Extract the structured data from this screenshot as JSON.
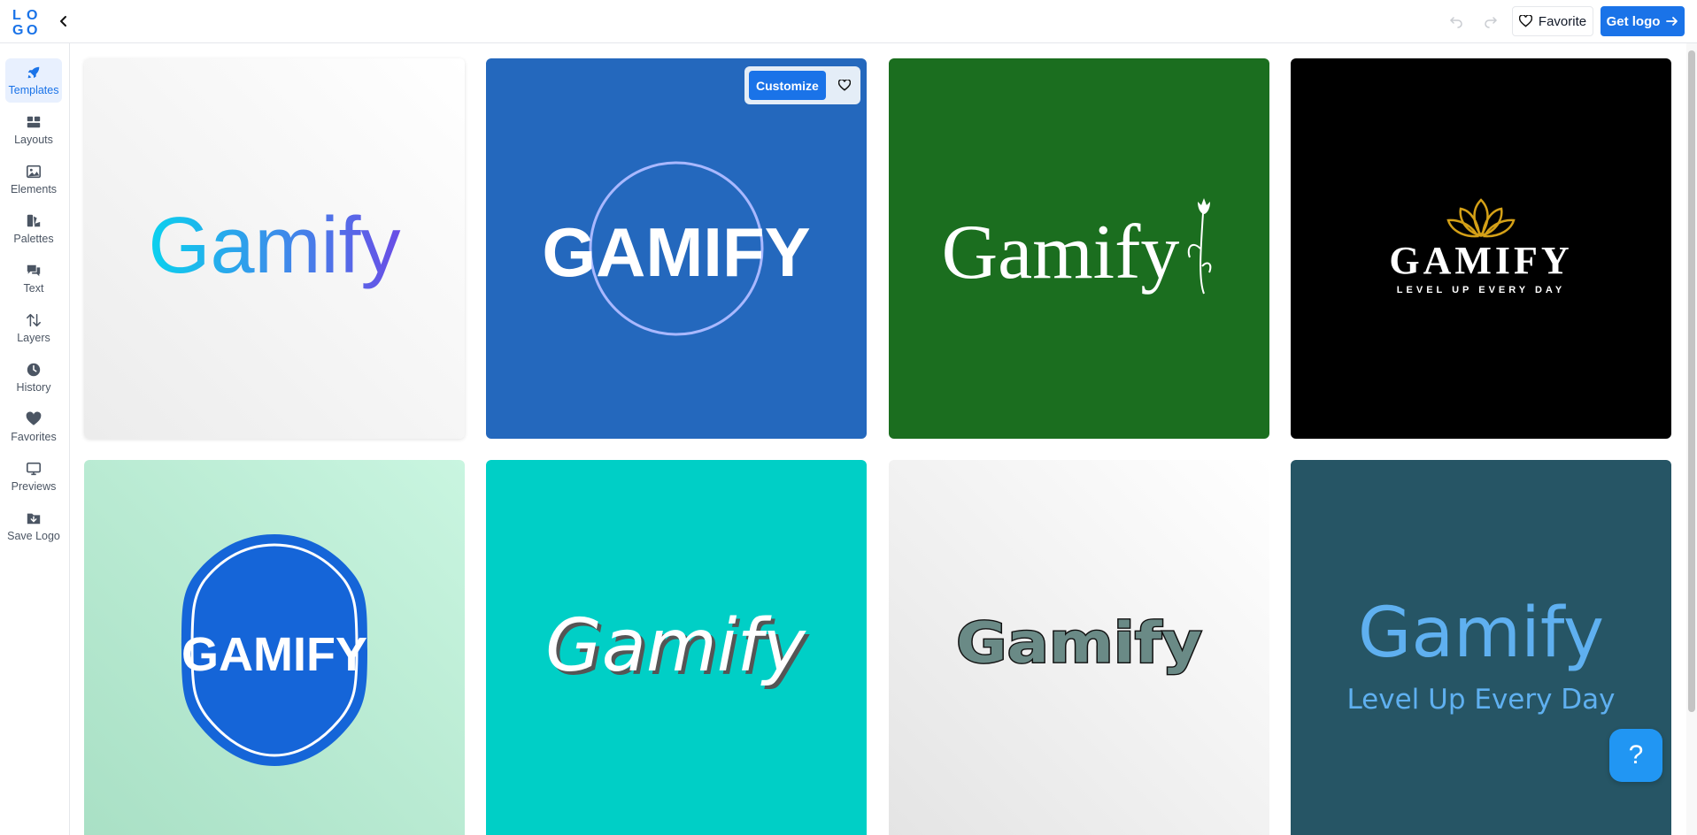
{
  "app": {
    "logo_letters": [
      "L",
      "O",
      "G",
      "O"
    ]
  },
  "toolbar": {
    "favorite_label": "Favorite",
    "get_logo_label": "Get logo"
  },
  "sidebar": {
    "items": [
      {
        "label": "Templates",
        "icon": "rocket-icon",
        "active": true
      },
      {
        "label": "Layouts",
        "icon": "layouts-icon",
        "active": false
      },
      {
        "label": "Elements",
        "icon": "image-icon",
        "active": false
      },
      {
        "label": "Palettes",
        "icon": "palette-icon",
        "active": false
      },
      {
        "label": "Text",
        "icon": "speech-bubbles-icon",
        "active": false
      },
      {
        "label": "Layers",
        "icon": "arrows-up-down-icon",
        "active": false
      },
      {
        "label": "History",
        "icon": "clock-icon",
        "active": false
      },
      {
        "label": "Favorites",
        "icon": "heart-icon",
        "active": false
      },
      {
        "label": "Previews",
        "icon": "monitor-icon",
        "active": false
      },
      {
        "label": "Save Logo",
        "icon": "download-folder-icon",
        "active": false
      }
    ]
  },
  "templates": [
    {
      "brand": "Gamify",
      "slogan": "",
      "style": "gradient-sans"
    },
    {
      "brand": "GAMIFY",
      "slogan": "",
      "style": "circle-blue"
    },
    {
      "brand": "Gamify",
      "slogan": "",
      "style": "serif-flower-green"
    },
    {
      "brand": "GAMIFY",
      "slogan": "LEVEL UP EVERY DAY",
      "style": "lotus-black"
    },
    {
      "brand": "GAMIFY",
      "slogan": "",
      "style": "badge-mint"
    },
    {
      "brand": "Gamify",
      "slogan": "",
      "style": "handwritten-teal"
    },
    {
      "brand": "Gamify",
      "slogan": "",
      "style": "blocky-gray"
    },
    {
      "brand": "Gamify",
      "slogan": "Level Up Every Day",
      "style": "light-slate"
    }
  ],
  "hover_card": {
    "customize_label": "Customize"
  },
  "help": {
    "label": "?"
  },
  "colors": {
    "accent": "#1a73e8",
    "card2_bg": "#2468bd",
    "card3_bg": "#1b6e1f",
    "card4_bg": "#000000",
    "card5_bg": "#bfeed6",
    "card6_bg": "#00cfc6",
    "card8_bg": "#265565"
  }
}
